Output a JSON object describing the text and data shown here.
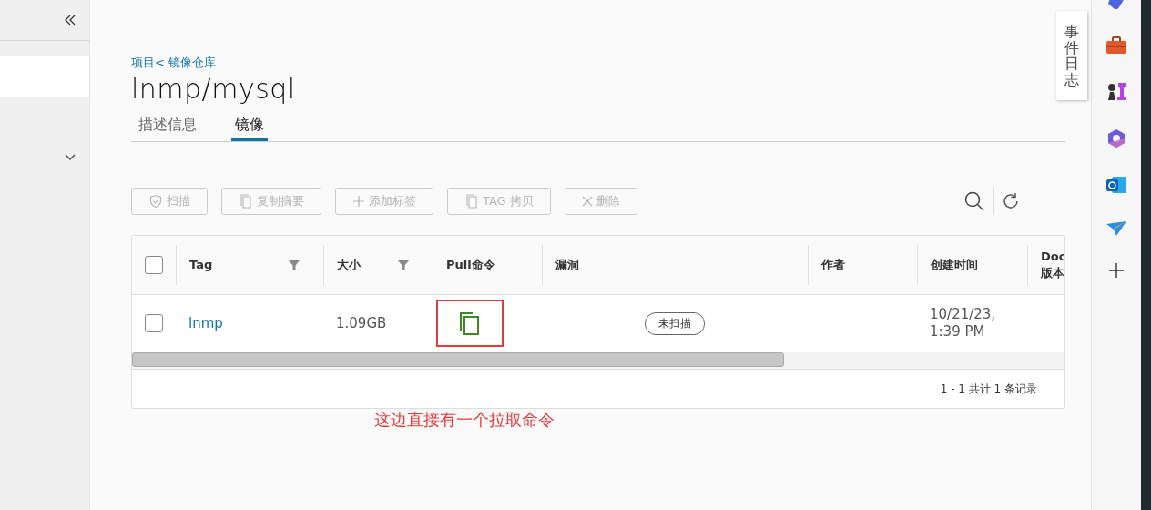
{
  "breadcrumb": "项目< 镜像仓库",
  "title": "lnmp/mysql",
  "tabs": [
    {
      "label": "描述信息",
      "selected": false
    },
    {
      "label": "镜像",
      "selected": true
    }
  ],
  "toolbar": [
    {
      "kind": "shield",
      "label": "扫描",
      "disabled": true
    },
    {
      "kind": "copy",
      "label": "复制摘要",
      "disabled": true
    },
    {
      "kind": "plus",
      "label": "添加标签",
      "disabled": true
    },
    {
      "kind": "copy",
      "label": "TAG 拷贝",
      "disabled": true
    },
    {
      "kind": "close",
      "label": "删除",
      "disabled": true
    }
  ],
  "table": {
    "all_checked": false,
    "columns": [
      {
        "label": "Tag",
        "filter": true
      },
      {
        "label": "大小",
        "filter": true
      },
      {
        "label": "Pull命令",
        "filter": false
      },
      {
        "label": "漏洞",
        "filter": false
      },
      {
        "label": "作者",
        "filter": false
      },
      {
        "label": "创建时间",
        "filter": false
      },
      {
        "label": "Doc 版本"
      }
    ],
    "rows": [
      {
        "checked": false,
        "tag": "lnmp",
        "size": "1.09GB",
        "vulnerability": "未扫描",
        "created": "10/21/23, 1:39 PM"
      }
    ],
    "pagination": "1 - 1 共计 1 条记录"
  },
  "annotation": "这边直接有一个拉取命令",
  "event_tab": "事件日志"
}
